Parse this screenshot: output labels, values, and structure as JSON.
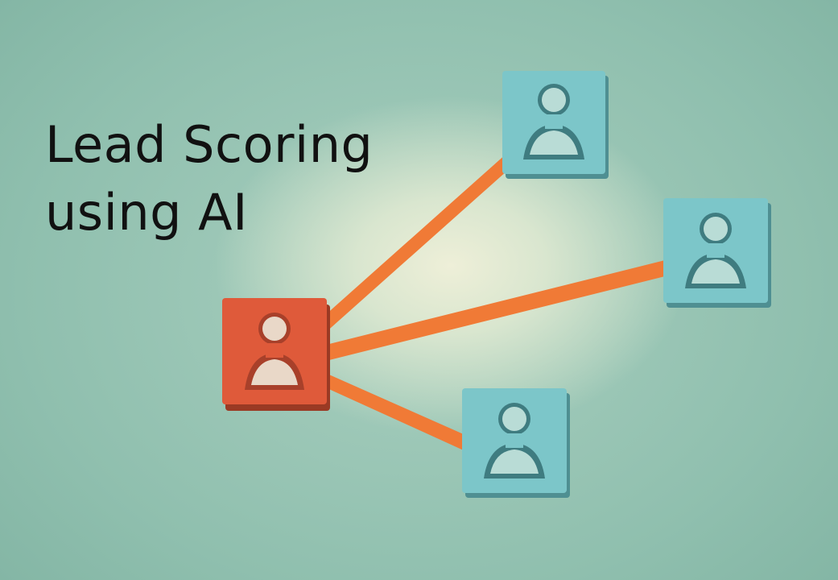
{
  "title": {
    "line1": "Lead Scoring",
    "line2": "using AI"
  },
  "colors": {
    "lead": "#df5a3a",
    "prospect": "#7cc6c9",
    "connector": "#f07a36",
    "text": "#111111"
  },
  "nodes": [
    {
      "role": "lead",
      "icon": "person-icon"
    },
    {
      "role": "prospect",
      "icon": "person-icon"
    },
    {
      "role": "prospect",
      "icon": "person-icon"
    },
    {
      "role": "prospect",
      "icon": "person-icon"
    }
  ]
}
